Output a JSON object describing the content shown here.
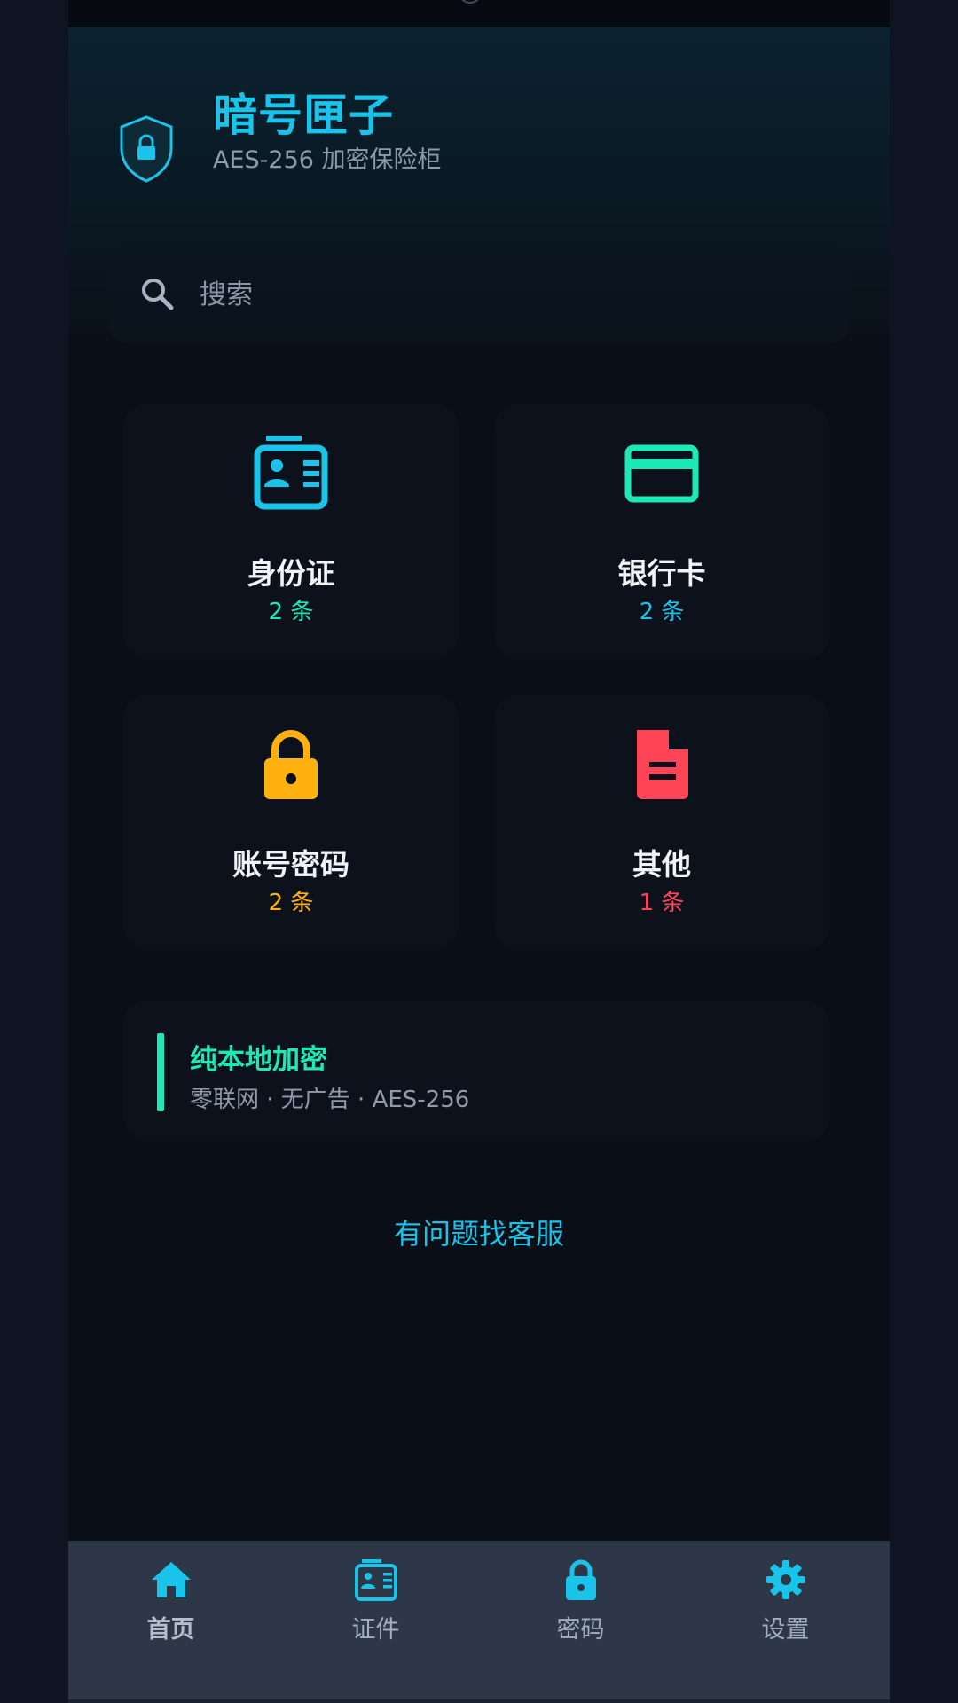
{
  "app": {
    "title": "暗号匣子",
    "subtitle": "AES-256 加密保险柜"
  },
  "search": {
    "placeholder": "搜索",
    "value": ""
  },
  "categories": [
    {
      "label": "身份证",
      "count": "2 条",
      "icon": "id-card-icon",
      "color": "#19c3ea",
      "count_color": "#1de9b6"
    },
    {
      "label": "银行卡",
      "count": "2 条",
      "icon": "credit-card-icon",
      "color": "#1de9b6",
      "count_color": "#19c3ea"
    },
    {
      "label": "账号密码",
      "count": "2 条",
      "icon": "lock-icon",
      "color": "#ffb20f",
      "count_color": "#ffb20f"
    },
    {
      "label": "其他",
      "count": "1 条",
      "icon": "document-icon",
      "color": "#ff4457",
      "count_color": "#ff4457"
    }
  ],
  "feature": {
    "title": "纯本地加密",
    "subtitle": "零联网 · 无广告 · AES-256"
  },
  "support_link": "有问题找客服",
  "nav": [
    {
      "label": "首页",
      "icon": "home-icon",
      "active": true
    },
    {
      "label": "证件",
      "icon": "id-card-icon",
      "active": false
    },
    {
      "label": "密码",
      "icon": "lock-icon",
      "active": false
    },
    {
      "label": "设置",
      "icon": "gear-icon",
      "active": false
    }
  ],
  "colors": {
    "accent": "#19c3ea",
    "secondary": "#1de9b6",
    "warning": "#ffb20f",
    "danger": "#ff4457",
    "nav_background": "#2d3748"
  }
}
